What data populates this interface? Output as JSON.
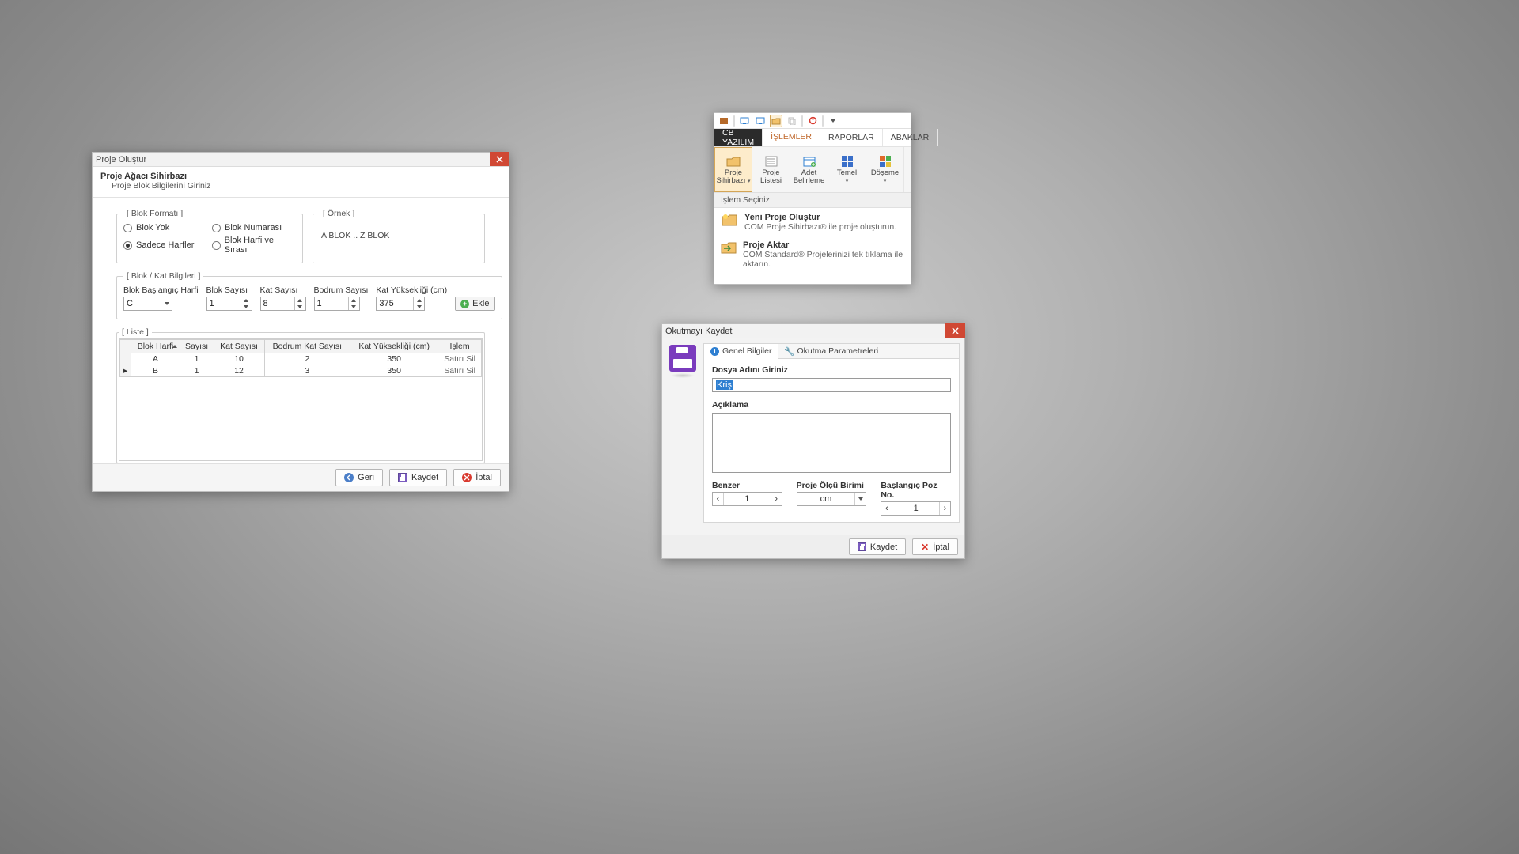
{
  "dlg1": {
    "title": "Proje Oluştur",
    "subtitle": "Proje Ağacı Sihirbazı",
    "subdesc": "Proje Blok Bilgilerini Giriniz",
    "blokformati_legend": "[ Blok Formatı ]",
    "ornek_legend": "[ Örnek ]",
    "ornek_text": "A BLOK .. Z BLOK",
    "blokkat_legend": "[ Blok / Kat Bilgileri ]",
    "liste_legend": "[ Liste ]",
    "radios": {
      "blok_yok": "Blok Yok",
      "blok_numarasi": "Blok Numarası",
      "sadece_harfler": "Sadece Harfler",
      "blok_harfi_sirasi": "Blok Harfi ve Sırası"
    },
    "fields": {
      "blok_baslangic_harfi": "Blok Başlangıç Harfi",
      "blok_sayisi": "Blok Sayısı",
      "kat_sayisi": "Kat Sayısı",
      "bodrum_sayisi": "Bodrum Sayısı",
      "kat_yuksekligi": "Kat Yüksekliği (cm)"
    },
    "values": {
      "blok_baslangic_harfi": "C",
      "blok_sayisi": "1",
      "kat_sayisi": "8",
      "bodrum_sayisi": "1",
      "kat_yuksekligi": "375"
    },
    "ekle_label": "Ekle",
    "table": {
      "headers": {
        "blok_harfi": "Blok Harfi",
        "sayisi": "Sayısı",
        "kat_sayisi": "Kat Sayısı",
        "bodrum_kat_sayisi": "Bodrum Kat Sayısı",
        "kat_yuksekligi": "Kat Yüksekliği (cm)",
        "islem": "İşlem"
      },
      "rows": [
        {
          "harf": "A",
          "sayi": "1",
          "kat": "10",
          "bodrum": "2",
          "yuk": "350",
          "islem": "Satırı Sil"
        },
        {
          "harf": "B",
          "sayi": "1",
          "kat": "12",
          "bodrum": "3",
          "yuk": "350",
          "islem": "Satırı Sil"
        }
      ]
    },
    "footer": {
      "geri": "Geri",
      "kaydet": "Kaydet",
      "iptal": "İptal"
    }
  },
  "ribbon": {
    "tabs": {
      "brand": "CB YAZILIM",
      "islemler": "İŞLEMLER",
      "raporlar": "RAPORLAR",
      "abaklar": "ABAKLAR"
    },
    "buttons": {
      "proje_sihirbazi": {
        "l1": "Proje",
        "l2": "Sihirbazı"
      },
      "proje_listesi": {
        "l1": "Proje",
        "l2": "Listesi"
      },
      "adet_belirleme": {
        "l1": "Adet",
        "l2": "Belirleme"
      },
      "temel": {
        "l1": "Temel",
        "l2": ""
      },
      "doseme": {
        "l1": "Döşeme",
        "l2": ""
      }
    },
    "drophdr": "İşlem Seçiniz",
    "menu": {
      "yeni": {
        "t": "Yeni Proje Oluştur",
        "d": "COM Proje Sihirbazı® ile proje oluşturun."
      },
      "aktar": {
        "t": "Proje Aktar",
        "d": "COM Standard® Projelerinizi tek tıklama ile aktarın."
      }
    }
  },
  "dlg2": {
    "title": "Okutmayı Kaydet",
    "tabs": {
      "genel": "Genel Bilgiler",
      "okutma": "Okutma Parametreleri"
    },
    "labels": {
      "dosya_adi": "Dosya Adını Giriniz",
      "aciklama": "Açıklama",
      "benzer": "Benzer",
      "olcu": "Proje Ölçü Birimi",
      "poz": "Başlangıç Poz No."
    },
    "values": {
      "dosya_adi": "Kriş",
      "benzer": "1",
      "olcu": "cm",
      "poz": "1"
    },
    "footer": {
      "kaydet": "Kaydet",
      "iptal": "İptal"
    }
  }
}
